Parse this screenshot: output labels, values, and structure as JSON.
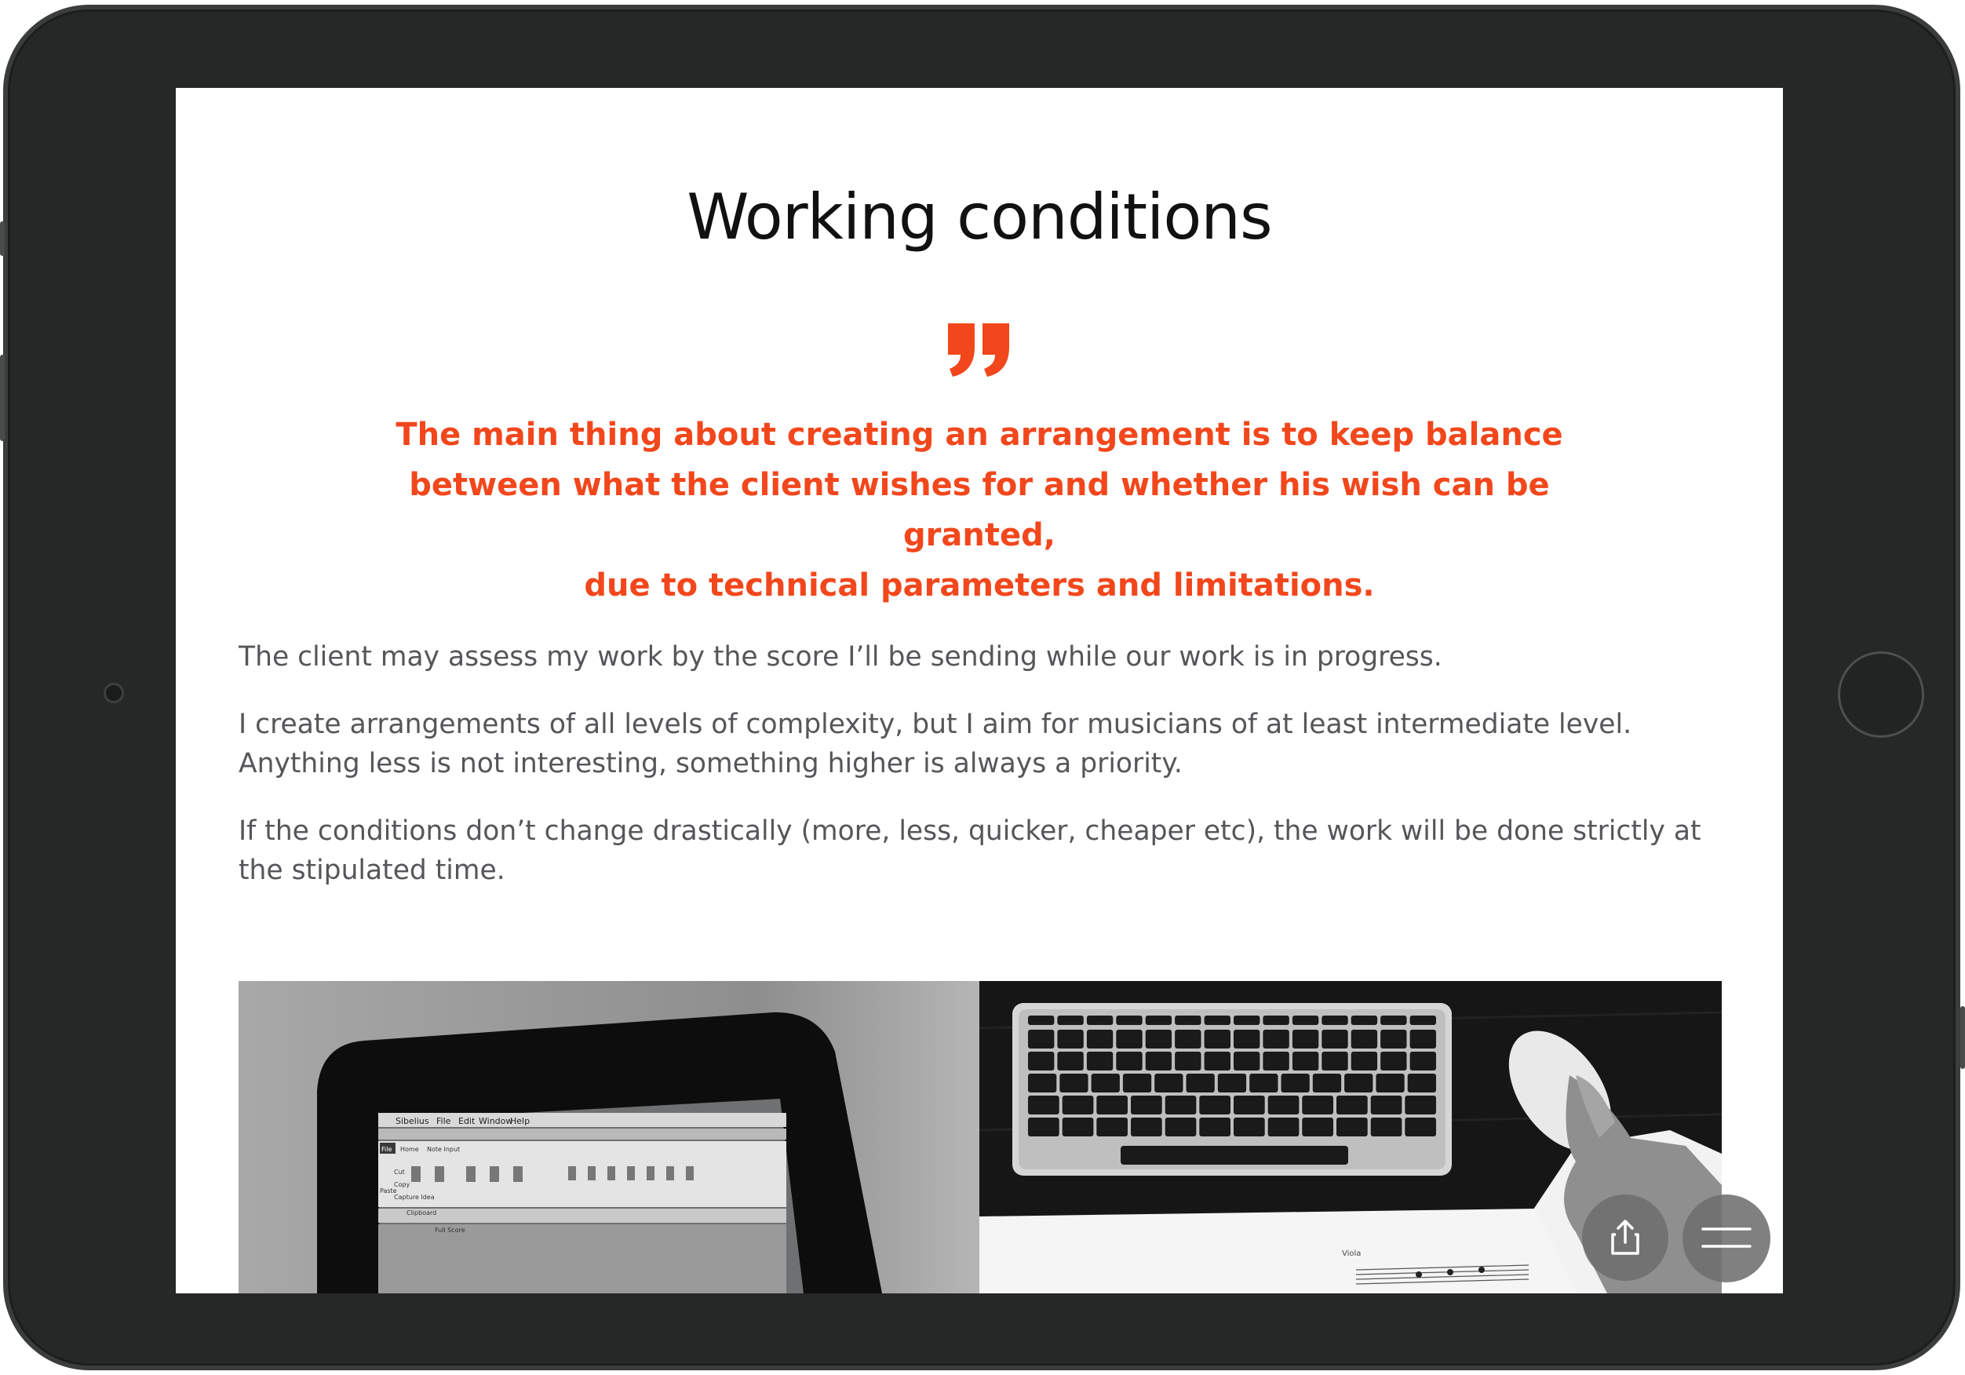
{
  "page": {
    "title": "Working conditions"
  },
  "quote": {
    "icon": "quote-mark-icon",
    "accent_color": "#f2471c",
    "lines": [
      "The main thing about creating an arrangement is to keep balance",
      "between what the client wishes for and whether his wish can be granted,",
      "due to technical parameters and limitations."
    ]
  },
  "body": {
    "paragraphs": [
      "The client may assess my work by the score I’ll be sending while our work is in progress.",
      "I create arrangements of all levels of complexity, but I aim for musicians of at least intermediate level. Anything less is not interesting, something higher is always a priority.",
      "If the conditions don’t change drastically (more, less, quicker, cheaper etc), the work will be done strictly at the stipulated time."
    ]
  },
  "images": {
    "left": {
      "app_menu": [
        "Sibelius",
        "File",
        "Edit",
        "Window",
        "Help"
      ],
      "ribbon_tabs": [
        "File",
        "Home",
        "Note Input"
      ],
      "clipboard_items": [
        "Cut",
        "Copy",
        "Paste",
        "Capture Idea",
        "Clipboard"
      ],
      "panel_label": "Full Score"
    },
    "right": {
      "sheet_label": "Viola"
    }
  },
  "floating_buttons": {
    "share_icon": "share-icon",
    "menu_icon": "hamburger-menu-icon"
  },
  "device": {
    "frame_color": "#262727",
    "screen_color": "#ffffff"
  }
}
